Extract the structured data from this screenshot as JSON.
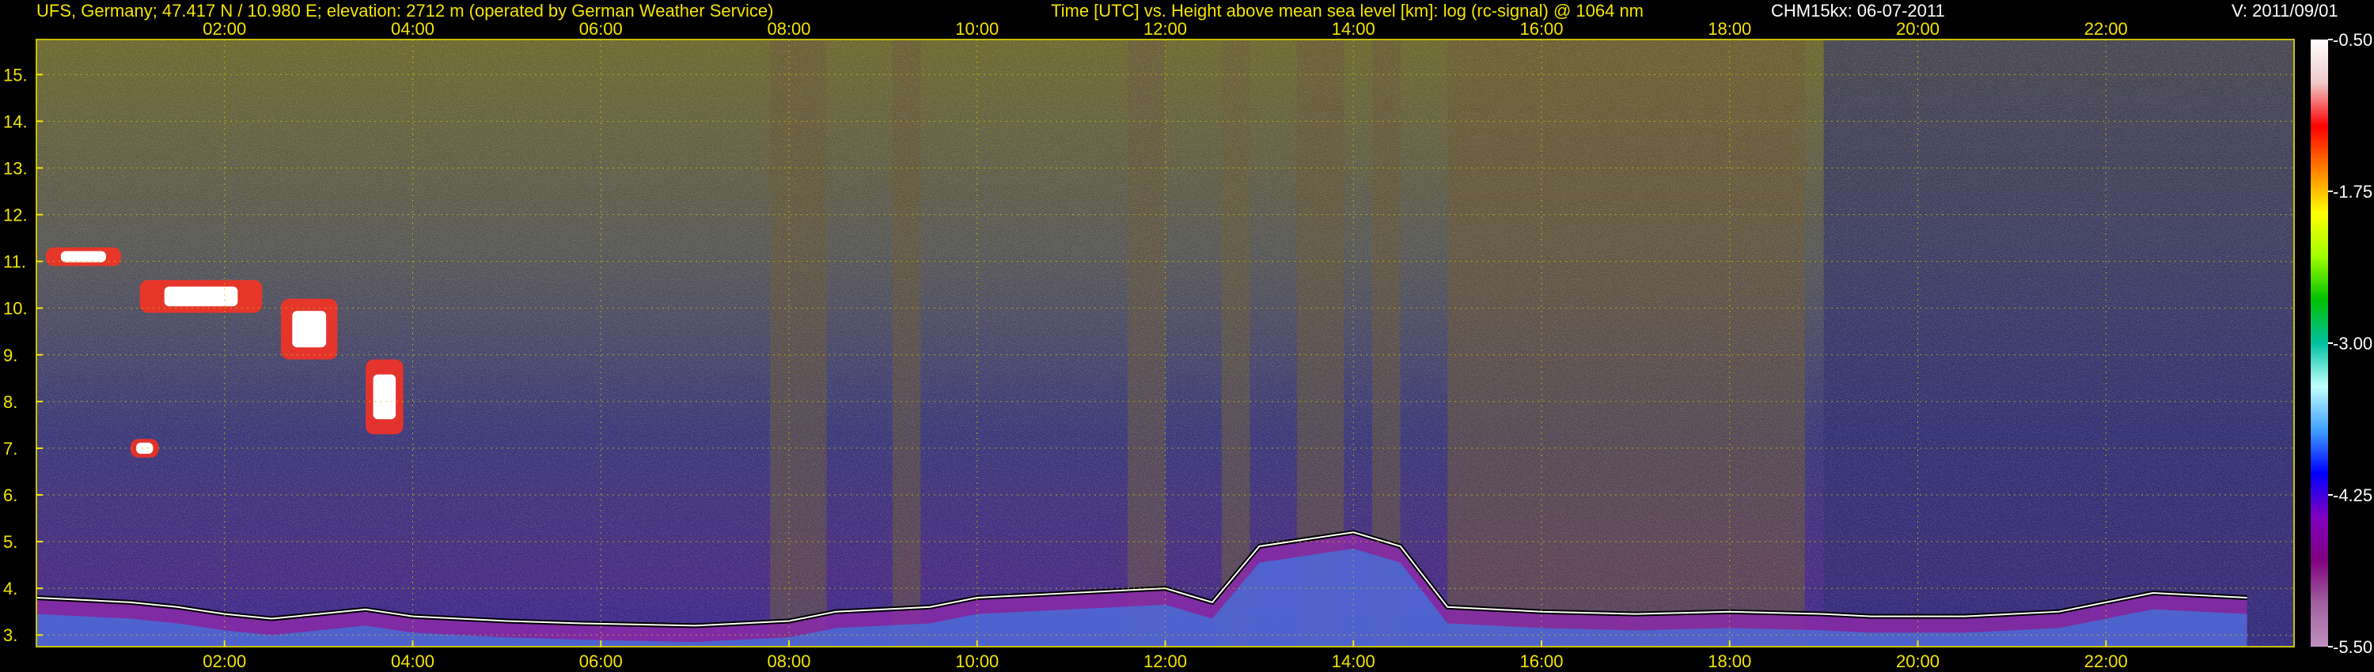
{
  "header": {
    "station": "UFS, Germany; 47.417 N / 10.980 E; elevation: 2712 m  (operated by German Weather Service)",
    "axes_description": "Time [UTC] vs. Height above mean sea level [km]: log (rc-signal) @ 1064 nm",
    "instrument_date": "CHM15kx: 06-07-2011",
    "version": "V: 2011/09/01"
  },
  "colors": {
    "label_yellow": "#f2e400",
    "grid_yellow": "#c8c000",
    "background": "#000000"
  },
  "chart_data": {
    "type": "heatmap",
    "xlabel": "Time [UTC]",
    "ylabel": "Height above mean sea level [km]",
    "variable": "log (rc-signal) @ 1064 nm",
    "x_ticks": [
      "02:00",
      "04:00",
      "06:00",
      "08:00",
      "10:00",
      "12:00",
      "14:00",
      "16:00",
      "18:00",
      "20:00",
      "22:00"
    ],
    "x_tick_hours": [
      2,
      4,
      6,
      8,
      10,
      12,
      14,
      16,
      18,
      20,
      22
    ],
    "xlim_hours": [
      0,
      24
    ],
    "y_ticks": [
      "3.",
      "4.",
      "5.",
      "6.",
      "7.",
      "8.",
      "9.",
      "10.",
      "11.",
      "12.",
      "13.",
      "14.",
      "15."
    ],
    "y_tick_values": [
      3,
      4,
      5,
      6,
      7,
      8,
      9,
      10,
      11,
      12,
      13,
      14,
      15
    ],
    "ylim_km": [
      2.75,
      15.75
    ],
    "grid": true,
    "colorbar": {
      "ticks": [
        "-0.50",
        "-1.75",
        "-3.00",
        "-4.25",
        "-5.50"
      ],
      "tick_values": [
        -0.5,
        -1.75,
        -3.0,
        -4.25,
        -5.5
      ],
      "range": [
        -5.5,
        -0.5
      ],
      "colors_high_to_low": [
        "#ffffff",
        "#f0c8c8",
        "#ff0000",
        "#ff8000",
        "#ffff00",
        "#a0ff00",
        "#00c000",
        "#00c0a0",
        "#c0ffff",
        "#40a0ff",
        "#0000ff",
        "#8000c0",
        "#800080",
        "#a060a0",
        "#c090c0"
      ]
    },
    "cloud_base_series": [
      {
        "h": 0.0,
        "km": 3.8
      },
      {
        "h": 0.5,
        "km": 3.75
      },
      {
        "h": 1.0,
        "km": 3.7
      },
      {
        "h": 1.5,
        "km": 3.6
      },
      {
        "h": 2.0,
        "km": 3.45
      },
      {
        "h": 2.5,
        "km": 3.35
      },
      {
        "h": 3.0,
        "km": 3.45
      },
      {
        "h": 3.5,
        "km": 3.55
      },
      {
        "h": 4.0,
        "km": 3.4
      },
      {
        "h": 5.0,
        "km": 3.3
      },
      {
        "h": 5.8,
        "km": 3.25
      },
      {
        "h": 7.0,
        "km": 3.2
      },
      {
        "h": 8.0,
        "km": 3.3
      },
      {
        "h": 8.5,
        "km": 3.5
      },
      {
        "h": 9.5,
        "km": 3.6
      },
      {
        "h": 10.0,
        "km": 3.8
      },
      {
        "h": 11.0,
        "km": 3.9
      },
      {
        "h": 12.0,
        "km": 4.0
      },
      {
        "h": 12.5,
        "km": 3.7
      },
      {
        "h": 13.0,
        "km": 4.9
      },
      {
        "h": 14.0,
        "km": 5.2
      },
      {
        "h": 14.5,
        "km": 4.9
      },
      {
        "h": 15.0,
        "km": 3.6
      },
      {
        "h": 16.0,
        "km": 3.5
      },
      {
        "h": 17.0,
        "km": 3.45
      },
      {
        "h": 18.0,
        "km": 3.5
      },
      {
        "h": 19.0,
        "km": 3.45
      },
      {
        "h": 19.5,
        "km": 3.4
      },
      {
        "h": 20.5,
        "km": 3.4
      },
      {
        "h": 21.5,
        "km": 3.5
      },
      {
        "h": 22.5,
        "km": 3.9
      },
      {
        "h": 23.5,
        "km": 3.8
      }
    ],
    "high_cloud_patches": [
      {
        "h0": 0.1,
        "h1": 0.9,
        "km0": 10.9,
        "km1": 11.3
      },
      {
        "h0": 1.1,
        "h1": 2.4,
        "km0": 9.9,
        "km1": 10.6
      },
      {
        "h0": 2.6,
        "h1": 3.2,
        "km0": 8.9,
        "km1": 10.2
      },
      {
        "h0": 3.5,
        "h1": 3.9,
        "km0": 7.3,
        "km1": 8.9
      },
      {
        "h0": 1.0,
        "h1": 1.3,
        "km0": 6.8,
        "km1": 7.2
      }
    ]
  }
}
